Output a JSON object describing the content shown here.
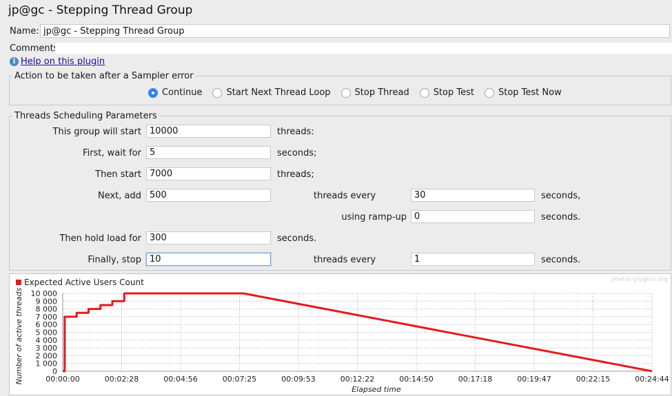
{
  "window": {
    "title": "jp@gc - Stepping Thread Group"
  },
  "name_field": {
    "label": "Name:",
    "value": "jp@gc - Stepping Thread Group"
  },
  "comments": {
    "label": "Comments:",
    "value": ""
  },
  "help": {
    "icon": "info-icon",
    "link_text": "Help on this plugin"
  },
  "sampler_error": {
    "legend": "Action to be taken after a Sampler error",
    "options": [
      {
        "label": "Continue",
        "selected": true
      },
      {
        "label": "Start Next Thread Loop",
        "selected": false
      },
      {
        "label": "Stop Thread",
        "selected": false
      },
      {
        "label": "Stop Test",
        "selected": false
      },
      {
        "label": "Stop Test Now",
        "selected": false
      }
    ]
  },
  "scheduling": {
    "legend": "Threads Scheduling Parameters",
    "start_label": "This group will start",
    "start_value": "10000",
    "start_unit": "threads:",
    "wait_label": "First, wait for",
    "wait_value": "5",
    "wait_unit": "seconds;",
    "then_start_label": "Then start",
    "then_start_value": "7000",
    "then_start_unit": "threads;",
    "next_add_label": "Next, add",
    "next_add_value": "500",
    "next_add_every": "threads every",
    "next_add_every_value": "30",
    "next_add_unit": "seconds,",
    "rampup_label": "using ramp-up",
    "rampup_value": "0",
    "rampup_unit": "seconds.",
    "hold_label": "Then hold load for",
    "hold_value": "300",
    "hold_unit": "seconds.",
    "stop_label": "Finally, stop",
    "stop_value": "10",
    "stop_every": "threads every",
    "stop_every_value": "1",
    "stop_unit": "seconds."
  },
  "chart_data": {
    "type": "line",
    "legend": "Expected Active Users Count",
    "watermark": "jmeter-plugins.org",
    "xlabel": "Elapsed time",
    "ylabel": "Number of active threads",
    "x_ticks": [
      "00:00:00",
      "00:02:28",
      "00:04:56",
      "00:07:25",
      "00:09:53",
      "00:12:22",
      "00:14:50",
      "00:17:18",
      "00:19:47",
      "00:22:15",
      "00:24:44"
    ],
    "y_ticks": [
      "0",
      "1 000",
      "2 000",
      "3 000",
      "4 000",
      "5 000",
      "6 000",
      "7 000",
      "8 000",
      "9 000",
      "10 000"
    ],
    "xlim_seconds": [
      0,
      1484
    ],
    "ylim": [
      0,
      10000
    ],
    "grid": true,
    "color": "#e41a1c",
    "series": [
      {
        "name": "Expected Active Users Count",
        "x_seconds": [
          0,
          5,
          5,
          35,
          35,
          65,
          65,
          95,
          95,
          125,
          125,
          155,
          155,
          455,
          1484
        ],
        "values": [
          0,
          0,
          7000,
          7000,
          7500,
          7500,
          8000,
          8000,
          8500,
          8500,
          9000,
          9000,
          10000,
          10000,
          0
        ]
      }
    ]
  }
}
